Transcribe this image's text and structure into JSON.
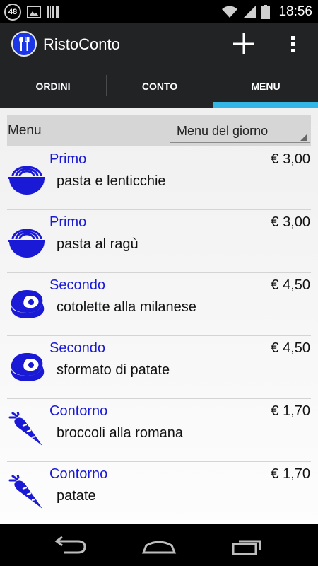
{
  "status_bar": {
    "notification_count": "48",
    "time": "18:56"
  },
  "app": {
    "title": "RistoConto",
    "brand_color": "#1a36e6",
    "accent_color": "#33b5e5"
  },
  "tabs": [
    {
      "label": "ORDINI",
      "selected": false
    },
    {
      "label": "CONTO",
      "selected": false
    },
    {
      "label": "MENU",
      "selected": true
    }
  ],
  "filter": {
    "label": "Menu",
    "selected_option": "Menu del giorno"
  },
  "menu_items": [
    {
      "category": "Primo",
      "name": "pasta e lenticchie",
      "price": "€ 3,00",
      "icon": "bowl-icon"
    },
    {
      "category": "Primo",
      "name": "pasta al ragù",
      "price": "€ 3,00",
      "icon": "bowl-icon"
    },
    {
      "category": "Secondo",
      "name": "cotolette alla milanese",
      "price": "€ 4,50",
      "icon": "meat-icon"
    },
    {
      "category": "Secondo",
      "name": "sformato di patate",
      "price": "€ 4,50",
      "icon": "meat-icon"
    },
    {
      "category": "Contorno",
      "name": "broccoli alla romana",
      "price": "€ 1,70",
      "icon": "carrot-icon"
    },
    {
      "category": "Contorno",
      "name": "patate",
      "price": "€ 1,70",
      "icon": "carrot-icon"
    }
  ]
}
